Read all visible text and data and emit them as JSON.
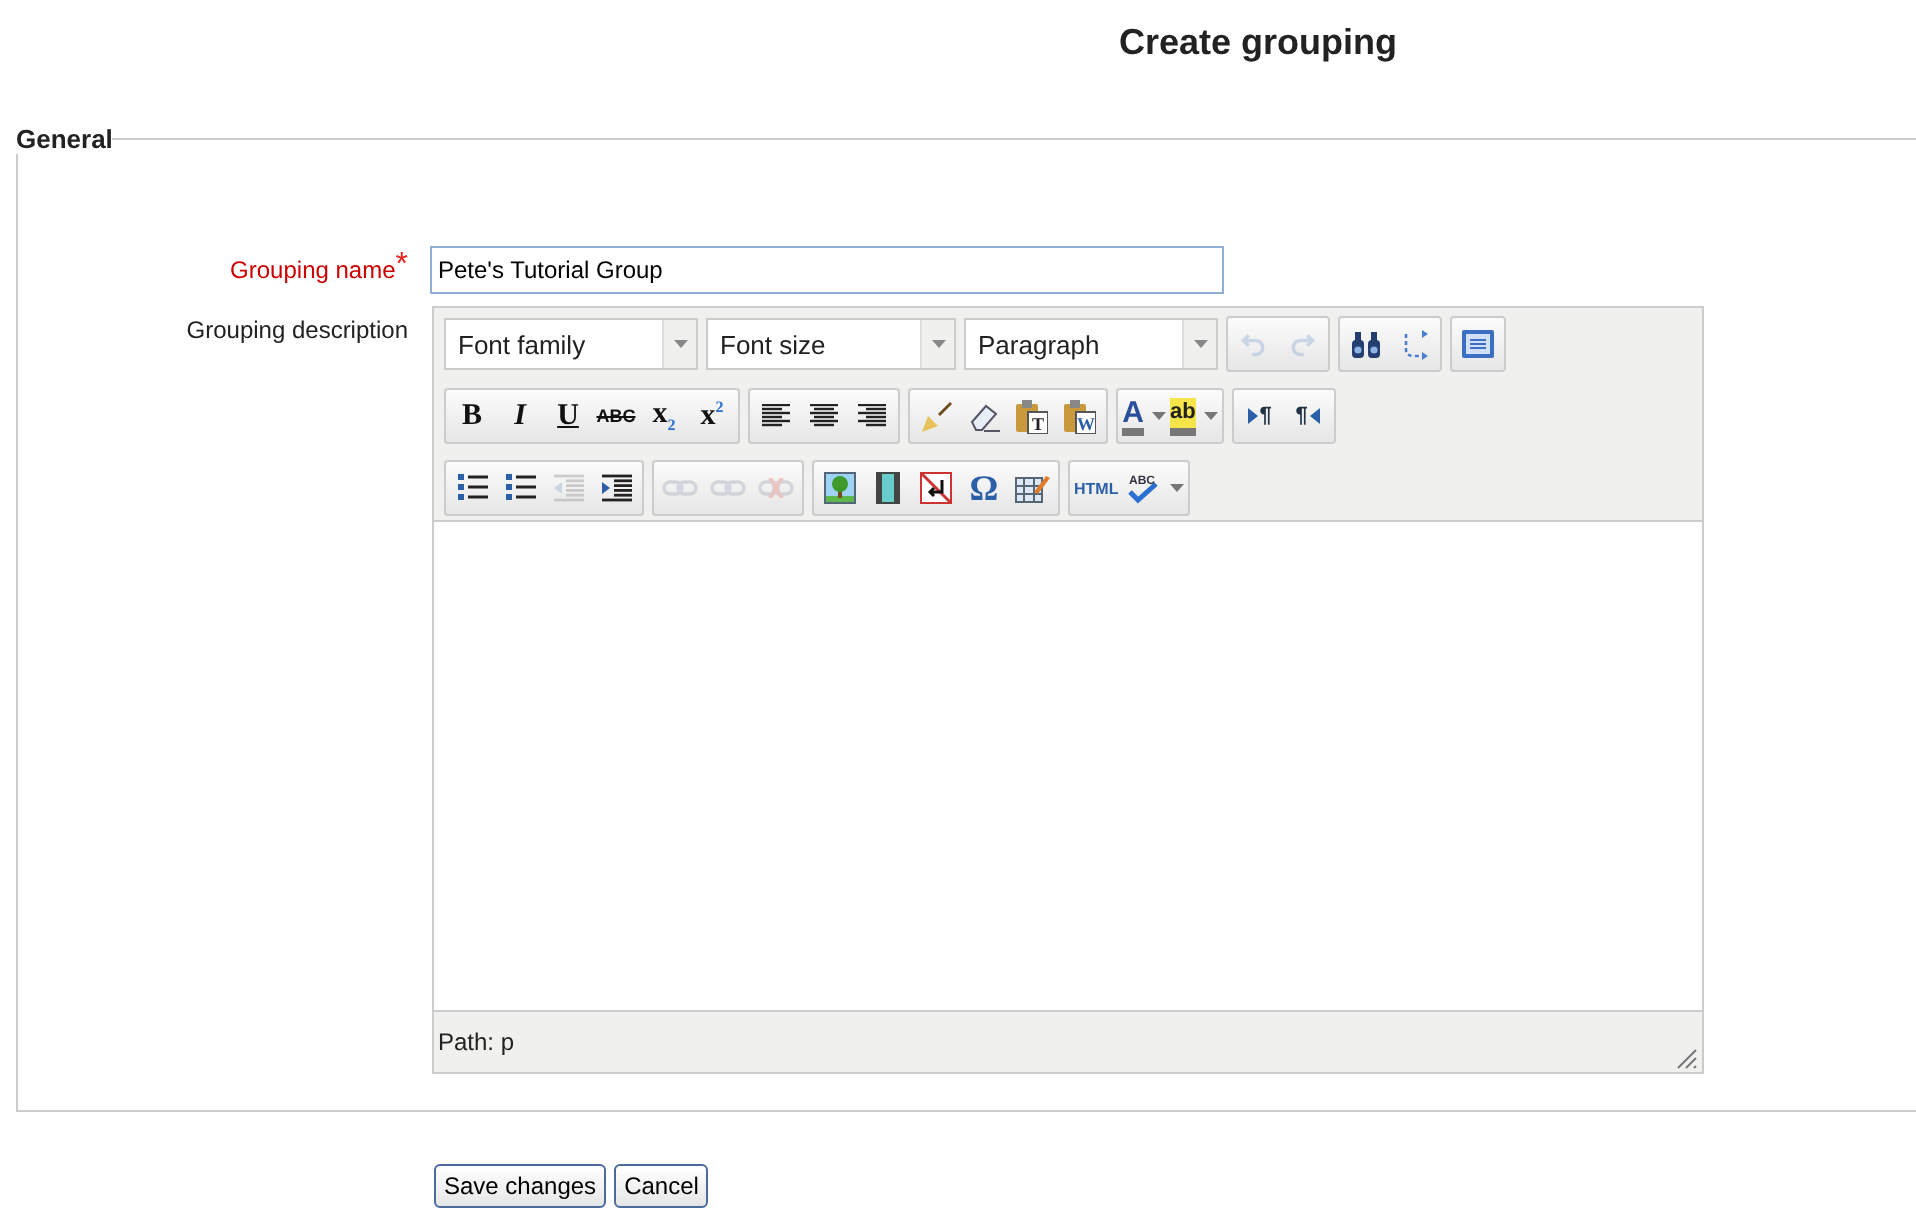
{
  "page_title": "Create grouping",
  "fieldset": {
    "legend": "General"
  },
  "fields": [
    {
      "label": "Grouping name",
      "required_mark": "*",
      "value": "Pete's Tutorial Group"
    }
  ],
  "editor": {
    "label": "Grouping description",
    "toolbar_rows": [
      {
        "selects": [
          {
            "label": "Font family"
          },
          {
            "label": "Font size"
          },
          {
            "label": "Paragraph"
          }
        ],
        "groups": [
          [
            {
              "kind": "undo",
              "disabled": true
            },
            {
              "kind": "redo",
              "disabled": true
            }
          ],
          [
            {
              "kind": "find",
              "disabled": false
            },
            {
              "kind": "replace",
              "disabled": false
            }
          ],
          [
            {
              "kind": "fullscreen",
              "disabled": false
            }
          ]
        ]
      },
      {
        "groups": [
          [
            {
              "kind": "bold",
              "label": "B",
              "disabled": false
            },
            {
              "kind": "italic",
              "label": "I",
              "disabled": false
            },
            {
              "kind": "underline",
              "label": "U",
              "disabled": false
            },
            {
              "kind": "strike",
              "label": "ABC",
              "disabled": false
            },
            {
              "kind": "subscript",
              "label": "x$_{2}$",
              "disabled": false
            },
            {
              "kind": "superscript",
              "label": "x$^{2}$",
              "disabled": false
            }
          ],
          [
            {
              "kind": "align-left",
              "disabled": false
            },
            {
              "kind": "align-center",
              "disabled": false
            },
            {
              "kind": "align-right",
              "disabled": false
            }
          ],
          [
            {
              "kind": "brush",
              "disabled": false
            },
            {
              "kind": "eraser",
              "disabled": false
            },
            {
              "kind": "paste",
              "label": "T",
              "disabled": false
            },
            {
              "kind": "paste",
              "label": "W",
              "disabled": false
            }
          ],
          [
            {
              "kind": "color",
              "label": "A",
              "disabled": false
            },
            {
              "kind": "highlight",
              "label": "ab",
              "disabled": false
            }
          ],
          [
            {
              "kind": "ltr",
              "label": "¶",
              "disabled": false
            },
            {
              "kind": "rtl",
              "label": "¶",
              "disabled": false
            }
          ]
        ]
      },
      {
        "groups": [
          [
            {
              "kind": "bullets",
              "disabled": false
            },
            {
              "kind": "numbers",
              "disabled": false
            },
            {
              "kind": "outdent",
              "disabled": true
            },
            {
              "kind": "indent",
              "disabled": false
            }
          ],
          [
            {
              "kind": "link",
              "disabled": true
            },
            {
              "kind": "unlink",
              "disabled": true
            },
            {
              "kind": "anchor",
              "disabled": true
            }
          ],
          [
            {
              "kind": "image",
              "disabled": false
            },
            {
              "kind": "media",
              "disabled": false
            },
            {
              "kind": "nonbreaking",
              "disabled": false
            },
            {
              "kind": "omega",
              "label": "Ω",
              "disabled": false
            },
            {
              "kind": "table",
              "disabled": false
            }
          ],
          [
            {
              "kind": "html",
              "label": "HTML",
              "disabled": false
            },
            {
              "kind": "spell",
              "label": "ABC",
              "disabled": false
            }
          ]
        ]
      }
    ],
    "path": "Path: p"
  },
  "buttons": [
    "Save changes",
    "Cancel"
  ]
}
